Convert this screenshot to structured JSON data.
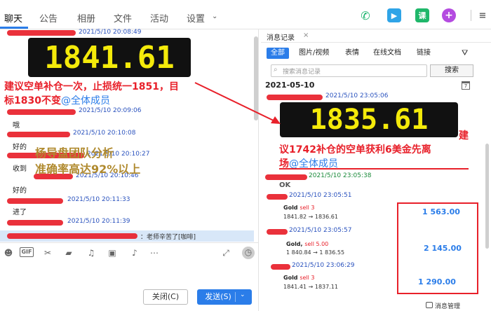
{
  "tabs": [
    "聊天",
    "公告",
    "相册",
    "文件",
    "活动",
    "设置"
  ],
  "top_icons": {
    "ke": "课",
    "plus": "+"
  },
  "chat": {
    "timestamps": [
      "2021/5/10 20:08:49",
      "2021/5/10 20:09:06",
      "2021/5/10 20:10:08",
      "2021/5/10 20:10:27",
      "2021/5/10 20:10:46",
      "2021/5/10 20:11:33",
      "2021/5/10 20:11:39"
    ],
    "board_value": "1841.61",
    "advice_line1": "建议空单补仓一次，止损统一1851，目",
    "advice_line2": "标1830不变",
    "mention": "@全体成员",
    "messages": [
      "哦",
      "好的",
      "收到",
      "好的",
      "进了"
    ],
    "overlay_line1": "杨导盘团队分析",
    "overlay_line2": "准确率高达92%以上",
    "quote": "：老师辛苦了[咖啡]"
  },
  "toolbar": {
    "gif": "GIF",
    "close_label": "关闭(C)",
    "send_label": "发送(S)"
  },
  "panel": {
    "title": "消息记录",
    "filters": [
      "全部",
      "图片/视频",
      "表情",
      "在线文档",
      "链接"
    ],
    "search_placeholder": "搜索消息记录",
    "search_button": "搜索",
    "date": "2021-05-10",
    "timestamps": [
      "2021/5/10 23:05:06",
      "2021/5/10 23:05:38",
      "2021/5/10 23:05:51",
      "2021/5/10 23:05:57",
      "2021/5/10 23:06:29"
    ],
    "board_value": "1835.61",
    "note_part1": "建",
    "note_line2a": "议1742补仓的空单获利6美金先离",
    "note_line3": "场",
    "mention": "@全体成员",
    "ok": "OK",
    "trades": [
      {
        "symbol": "Gold",
        "side": "sell 3",
        "prices": "1841.82 → 1836.61",
        "amount": "1 563.00"
      },
      {
        "symbol": "Gold,",
        "side": "sell 5.00",
        "prices": "1 840.84 → 1 836.55",
        "amount": "2 145.00"
      },
      {
        "symbol": "Gold",
        "side": "sell 3",
        "prices": "1841.41 → 1837.11",
        "amount": "1 290.00"
      }
    ],
    "footer": "消息管理"
  },
  "colors": {
    "accent": "#2b7de9",
    "red": "#e8202a",
    "board_text": "#f4ea0a"
  }
}
